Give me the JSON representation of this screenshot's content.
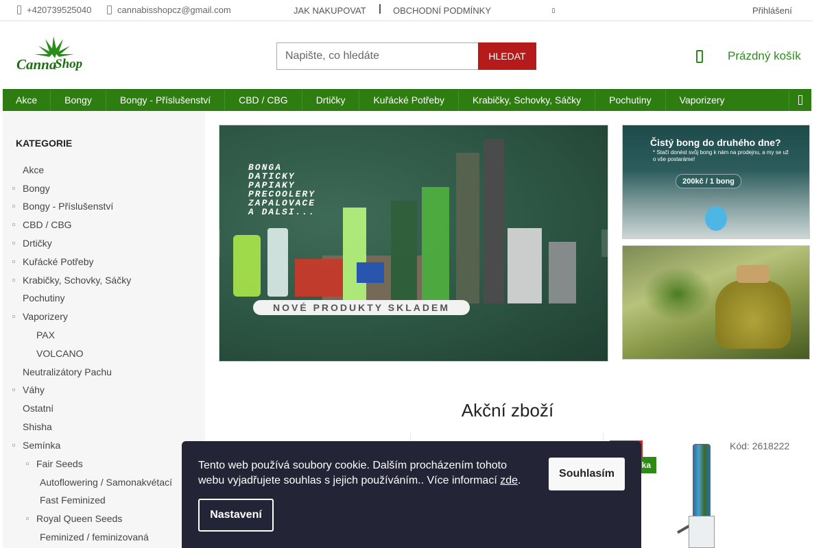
{
  "topbar": {
    "phone": "+420739525040",
    "email": "cannabisshopcz@gmail.com",
    "links": [
      "JAK NAKUPOVAT",
      "OBCHODNÍ PODMÍNKY"
    ],
    "login": "Přihlášení"
  },
  "header": {
    "logo_text": "CannabiShop",
    "search_placeholder": "Napište, co hledáte",
    "search_button": "HLEDAT",
    "cart_label": "Prázdný košík"
  },
  "nav": {
    "items": [
      "Akce",
      "Bongy",
      "Bongy - Příslušenství",
      "CBD / CBG",
      "Drtičky",
      "Kuřácké Potřeby",
      "Krabičky, Schovky, Sáčky",
      "Pochutiny",
      "Vaporizery"
    ]
  },
  "sidebar": {
    "title": "KATEGORIE",
    "items": [
      {
        "label": "Akce"
      },
      {
        "label": "Bongy"
      },
      {
        "label": "Bongy - Příslušenství"
      },
      {
        "label": "CBD / CBG"
      },
      {
        "label": "Drtičky"
      },
      {
        "label": "Kuřácké Potřeby"
      },
      {
        "label": "Krabičky, Schovky, Sáčky"
      },
      {
        "label": "Pochutiny"
      },
      {
        "label": "Vaporizery"
      },
      {
        "label": "PAX"
      },
      {
        "label": "VOLCANO"
      },
      {
        "label": "Neutralizátory Pachu"
      },
      {
        "label": "Váhy"
      },
      {
        "label": "Ostatní"
      },
      {
        "label": "Shisha"
      },
      {
        "label": "Semínka"
      },
      {
        "label": "Fair Seeds"
      },
      {
        "label": "Autoflowering / Samonakvétací"
      },
      {
        "label": "Fast Feminized"
      },
      {
        "label": "Royal Queen Seeds"
      },
      {
        "label": "Feminized / feminizovaná"
      }
    ]
  },
  "banner": {
    "lines": [
      "BONGA",
      "DATICKY",
      "PAPIAKY",
      "PRECOOLERY",
      "ZAPALOVACE",
      "A DALSI..."
    ],
    "pill": "NOVÉ PRODUKTY SKLADEM"
  },
  "promo1": {
    "headline": "Čistý bong do druhého dne?",
    "subtext": "* Stačí donést svůj bong k nám na prodejnu, a my se už o vše postaráme!",
    "price": "200kč / 1 bong"
  },
  "main": {
    "section_title": "Akční zboží",
    "product_tag": "ka",
    "product_code": "Kód: 2618222"
  },
  "cookie": {
    "text": "Tento web používá soubory cookie. Dalším procházením tohoto webu vyjadřujete souhlas s jejich používáním.. Více informací",
    "link": "zde",
    "after_link": ".",
    "agree": "Souhlasím",
    "settings": "Nastavení"
  },
  "colors": {
    "nav_green": "#2e7d10",
    "accent_red": "#b51b1b",
    "cookie_bg": "#232435",
    "cart_green": "#2c8a1c"
  }
}
